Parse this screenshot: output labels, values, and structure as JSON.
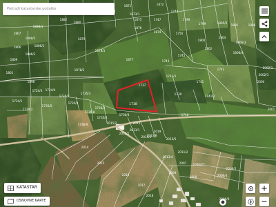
{
  "search": {
    "placeholder": "Pretraži katastarske podatke",
    "value": ""
  },
  "layers": {
    "katastar_label": "KATASTAR",
    "osnovne_karte_label": "OSNOVNE KARTE"
  },
  "toolbar": {
    "menu_icon": "hamburger-menu-icon",
    "share_icon": "share-icon",
    "expand_icon": "chevron-up-icon"
  },
  "map_controls": {
    "zoom_in_icon": "plus-icon",
    "zoom_out_icon": "minus-icon",
    "locate_icon": "locate-target-icon",
    "compass_icon": "compass-icon",
    "help_icon": "help-icon"
  },
  "colors": {
    "parcel_line": "#f2f2f2",
    "selected_parcel": "#e8202a",
    "label_text": "#ffffff"
  },
  "selected_parcel_label": "1738",
  "parcel_labels": [
    "1871",
    "1872",
    "1873/1",
    "1874",
    "1875",
    "1876",
    "1803",
    "1880",
    "1882",
    "1888/1",
    "1879",
    "1878/1",
    "1807",
    "1806",
    "1808/2",
    "1809",
    "1886/1",
    "1886/2",
    "1801",
    "1896",
    "1878/2",
    "1677",
    "1748",
    "1747",
    "1749",
    "1750",
    "1799",
    "1800",
    "1802",
    "1804",
    "1805/2",
    "1805",
    "1806/3",
    "1806/4",
    "1808",
    "1743",
    "1745",
    "1742",
    "1741/1",
    "1741/2",
    "1739",
    "1737",
    "1740",
    "1724/4",
    "1724/1",
    "1724/2",
    "1735/1",
    "1735/2",
    "1735/3",
    "1736/2",
    "1736/8",
    "1730/4",
    "1736/9",
    "1735/4",
    "2013",
    "2013/1",
    "2015/2",
    "2013/3",
    "2015/1",
    "2014",
    "2015",
    "2016",
    "2017",
    "2018",
    "2019",
    "2013/5",
    "2013/4",
    "2011/2",
    "2007",
    "2008",
    "2006/27",
    "2006/2",
    "2006/4",
    "2006/9",
    "2002/1",
    "2002/3",
    "2000",
    "2001",
    "1741",
    "1724/3",
    "2009",
    "1735/5",
    "2013/8"
  ]
}
